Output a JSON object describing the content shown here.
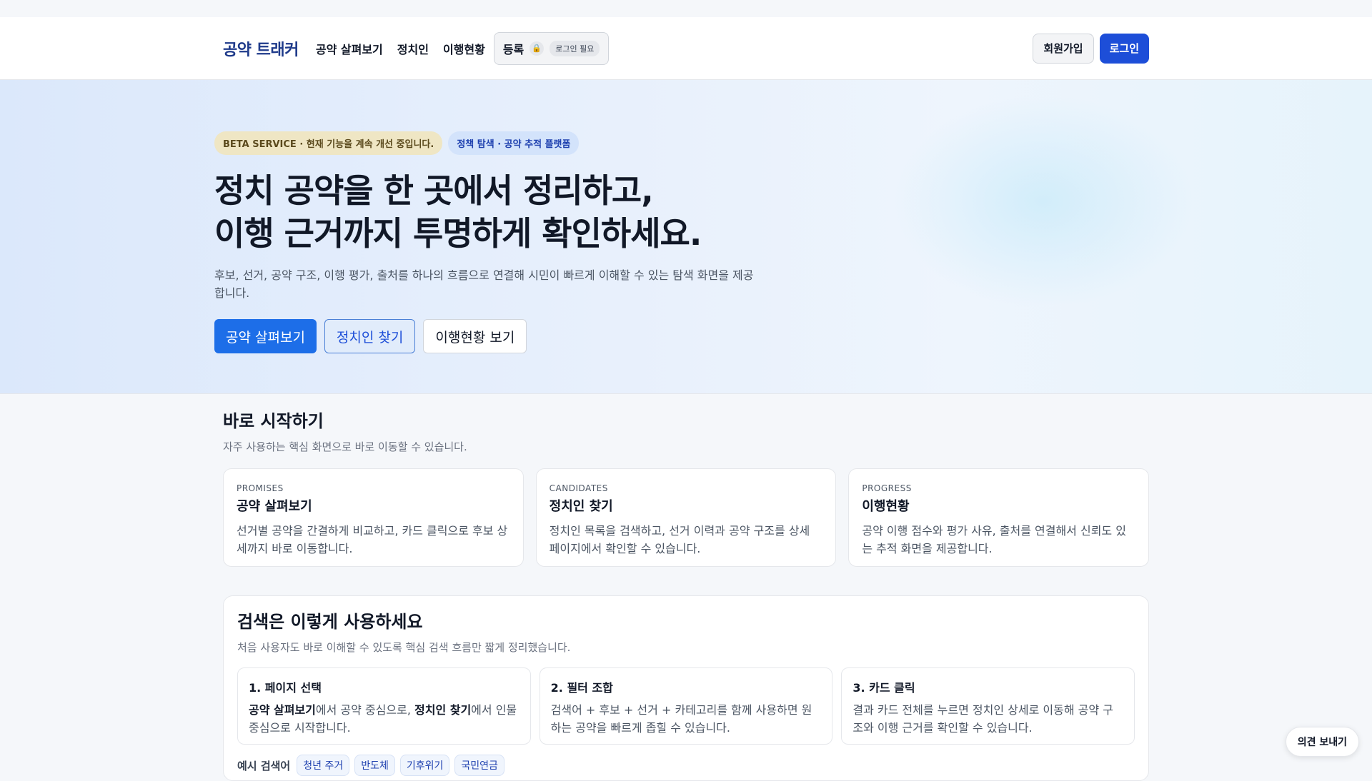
{
  "nav": {
    "brand": "공약 트래커",
    "links": [
      "공약 살펴보기",
      "정치인",
      "이행현황"
    ],
    "register_label": "등록",
    "lock_icon": "lock-icon",
    "login_required": "로그인 필요",
    "signup": "회원가입",
    "login": "로그인"
  },
  "hero": {
    "badge_beta": "BETA SERVICE · 현재 기능을 계속 개선 중입니다.",
    "badge_platform": "정책 탐색 · 공약 추적 플랫폼",
    "title_line1": "정치 공약을 한 곳에서 정리하고,",
    "title_line2": "이행 근거까지 투명하게 확인하세요.",
    "subtitle": "후보, 선거, 공약 구조, 이행 평가, 출처를 하나의 흐름으로 연결해 시민이 빠르게 이해할 수 있는 탐색 화면을 제공합니다.",
    "buttons": [
      "공약 살펴보기",
      "정치인 찾기",
      "이행현황 보기"
    ]
  },
  "quick_start": {
    "title": "바로 시작하기",
    "subtitle": "자주 사용하는 핵심 화면으로 바로 이동할 수 있습니다.",
    "cards": [
      {
        "kicker": "PROMISES",
        "title": "공약 살펴보기",
        "desc": "선거별 공약을 간결하게 비교하고, 카드 클릭으로 후보 상세까지 바로 이동합니다."
      },
      {
        "kicker": "CANDIDATES",
        "title": "정치인 찾기",
        "desc": "정치인 목록을 검색하고, 선거 이력과 공약 구조를 상세 페이지에서 확인할 수 있습니다."
      },
      {
        "kicker": "PROGRESS",
        "title": "이행현황",
        "desc": "공약 이행 점수와 평가 사유, 출처를 연결해서 신뢰도 있는 추적 화면을 제공합니다."
      }
    ]
  },
  "guide": {
    "title": "검색은 이렇게 사용하세요",
    "subtitle": "처음 사용자도 바로 이해할 수 있도록 핵심 검색 흐름만 짧게 정리했습니다.",
    "steps": [
      {
        "title": "1. 페이지 선택",
        "bold1": "공약 살펴보기",
        "text1": "에서 공약 중심으로, ",
        "bold2": "정치인 찾기",
        "text2": "에서 인물 중심으로 시작합니다."
      },
      {
        "title": "2. 필터 조합",
        "desc": "검색어 + 후보 + 선거 + 카테고리를 함께 사용하면 원하는 공약을 빠르게 좁힐 수 있습니다."
      },
      {
        "title": "3. 카드 클릭",
        "desc": "결과 카드 전체를 누르면 정치인 상세로 이동해 공약 구조와 이행 근거를 확인할 수 있습니다."
      }
    ],
    "examples_label": "예시 검색어",
    "examples": [
      "청년 주거",
      "반도체",
      "기후위기",
      "국민연금"
    ]
  },
  "feedback": "의견 보내기"
}
